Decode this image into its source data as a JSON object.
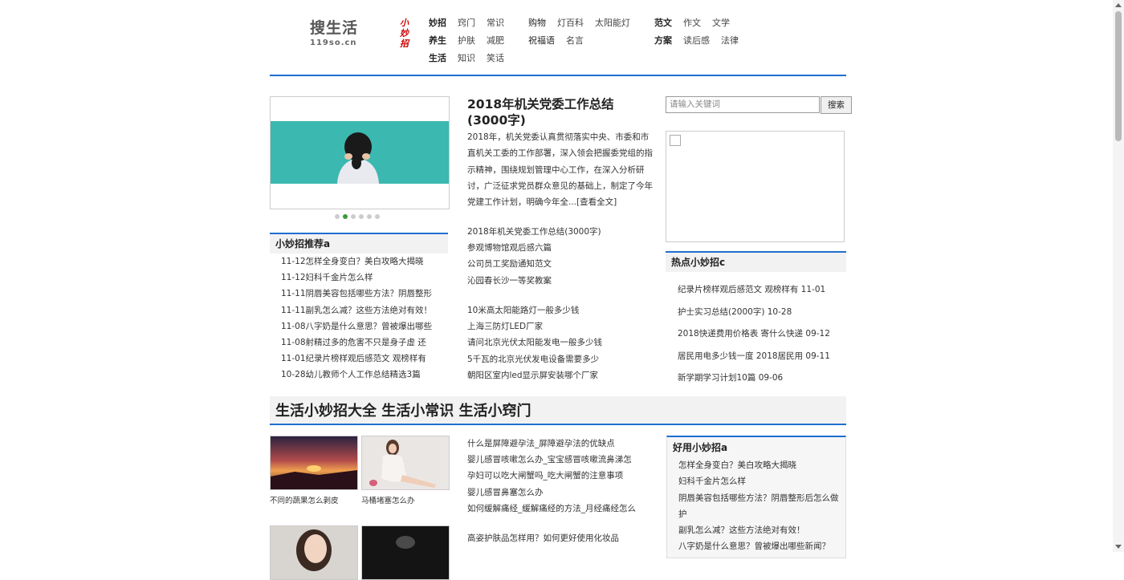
{
  "header": {
    "logo_text": "搜生活",
    "logo_sub": "119so.cn",
    "brand_vertical": "小妙招",
    "nav1": [
      {
        "cat": "妙招",
        "items": [
          "窍门",
          "常识"
        ]
      },
      {
        "cat": "养生",
        "items": [
          "护肤",
          "减肥"
        ]
      },
      {
        "cat": "生活",
        "items": [
          "知识",
          "笑话"
        ]
      }
    ],
    "nav2": [
      {
        "cat": "购物",
        "items": [
          "灯百科",
          "太阳能灯"
        ]
      },
      {
        "cat": "祝福语",
        "items": [
          "名言"
        ]
      }
    ],
    "nav3": [
      {
        "cat": "范文",
        "items": [
          "作文",
          "文学"
        ]
      },
      {
        "cat": "方案",
        "items": [
          "读后感",
          "法律"
        ]
      }
    ]
  },
  "recommend": {
    "title": "小妙招推荐a",
    "items": [
      "11-12怎样全身变白？美白攻略大揭晓",
      "11-12妇科千金片怎么样",
      "11-11阴唇美容包括哪些方法？阴唇整形",
      "11-11副乳怎么减？这些方法绝对有效！",
      "11-08八字奶是什么意思？曾被爆出哪些",
      "11-08射精过多的危害不只是身子虚 还",
      "11-01纪录片榜样观后感范文 观榜样有",
      "10-28幼儿教师个人工作总结精选3篇"
    ]
  },
  "article": {
    "title": "2018年机关党委工作总结(3000字)",
    "body": "2018年，机关党委认真贯彻落实中央、市委和市直机关工委的工作部署，深入领会把握委党组的指示精神，围绕规划管理中心工作，在深入分析研讨，广泛征求党员群众意见的基础上，制定了今年党建工作计划，明确今年全...",
    "more": "[查看全文]",
    "links1": [
      "2018年机关党委工作总结(3000字)",
      "参观博物馆观后感六篇",
      "公司员工奖励通知范文",
      "沁园春长沙一等奖教案"
    ],
    "links2": [
      "10米高太阳能路灯一般多少钱",
      "上海三防灯LED厂家",
      "请问北京光伏太阳能发电一般多少钱",
      "5千瓦的北京光伏发电设备需要多少",
      "朝阳区室内led显示屏安装哪个厂家"
    ]
  },
  "search": {
    "placeholder": "请输入关键词",
    "button": "搜索"
  },
  "hot": {
    "title": "热点小妙招c",
    "items": [
      "纪录片榜样观后感范文 观榜样有 11-01",
      "护士实习总结(2000字) 10-28",
      "2018快递费用价格表 寄什么快递 09-12",
      "居民用电多少钱一度 2018居民用 09-11",
      "新学期学习计划10篇 09-06"
    ]
  },
  "section2": {
    "title": "生活小妙招大全 生活小常识 生活小窍门",
    "thumbs": [
      {
        "caption": "不同的蔬果怎么剥皮"
      },
      {
        "caption": "马桶堵塞怎么办"
      },
      {
        "caption": ""
      },
      {
        "caption": ""
      }
    ],
    "links1": [
      "什么是屏障避孕法_屏障避孕法的优缺点",
      "婴儿感冒咳嗽怎么办_宝宝感冒咳嗽流鼻涕怎",
      "孕妇可以吃大闸蟹吗_吃大闸蟹的注意事项",
      "婴儿感冒鼻塞怎么办",
      "如何缓解痛经_缓解痛经的方法_月经痛经怎么"
    ],
    "links2": [
      "高姿护肤品怎样用？如何更好使用化妆品"
    ],
    "useful": {
      "title": "好用小妙招a",
      "items": [
        "怎样全身变白？美白攻略大揭晓",
        "妇科千金片怎么样",
        "阴唇美容包括哪些方法？阴唇整形后怎么做护",
        "副乳怎么减？这些方法绝对有效！",
        "八字奶是什么意思？曾被爆出哪些新闻？"
      ]
    }
  },
  "colors": {
    "accent": "#1e6fd0",
    "brand_red": "#cc0000",
    "slider_sea": "#3bb8b0"
  }
}
